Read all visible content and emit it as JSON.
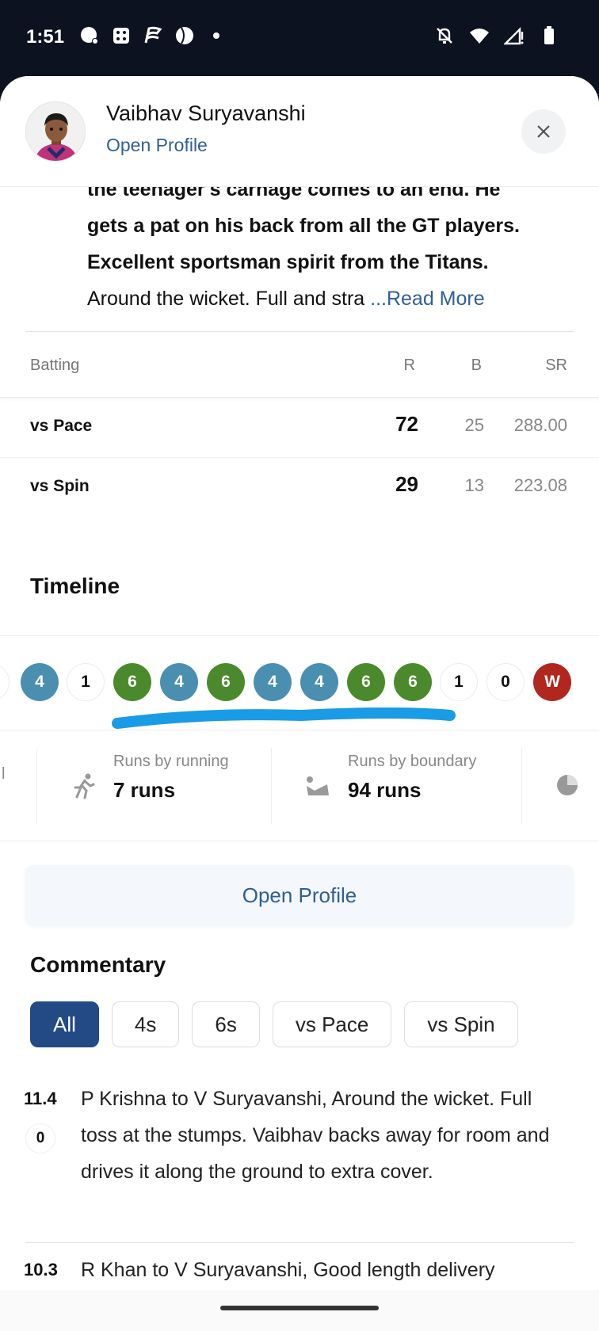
{
  "status_bar": {
    "time": "1:51",
    "notification_icons": [
      "chat-bubble-icon",
      "dice-icon",
      "flag-icon",
      "cricket-ball-icon",
      "dot-icon"
    ],
    "system_icons": [
      "bell-off-icon",
      "wifi-icon",
      "signal-icon",
      "battery-icon"
    ]
  },
  "header": {
    "player_name": "Vaibhav Suryavanshi",
    "open_profile": "Open Profile"
  },
  "summary": {
    "line1": "the teenager's carnage comes to an end. He",
    "line2": "gets a pat on his back from all the GT players.",
    "line3": "Excellent sportsman spirit from the Titans.",
    "line4": "Around the wicket. Full and stra",
    "read_more": "...Read More"
  },
  "batting": {
    "headers": {
      "label": "Batting",
      "r": "R",
      "b": "B",
      "sr": "SR"
    },
    "rows": [
      {
        "label": "vs Pace",
        "r": "72",
        "b": "25",
        "sr": "288.00"
      },
      {
        "label": "vs Spin",
        "r": "29",
        "b": "13",
        "sr": "223.08"
      }
    ]
  },
  "timeline": {
    "title": "Timeline",
    "balls": [
      "4",
      "1",
      "6",
      "4",
      "6",
      "4",
      "4",
      "6",
      "6",
      "1",
      "0",
      "W"
    ]
  },
  "stats": {
    "running": {
      "caption": "Runs by running",
      "value": "7 runs"
    },
    "boundary": {
      "caption": "Runs by boundary",
      "value": "94 runs"
    }
  },
  "open_profile_button": "Open Profile",
  "commentary": {
    "title": "Commentary",
    "filters": [
      "All",
      "4s",
      "6s",
      "vs Pace",
      "vs Spin"
    ],
    "active_filter": "All",
    "items": [
      {
        "over": "11.4",
        "runs": "0",
        "text": "P Krishna to V Suryavanshi, Around the wicket. Full toss at the stumps. Vaibhav backs away for room and drives it along the ground to extra cover."
      },
      {
        "over": "10.3",
        "runs": "",
        "text": "R Khan to V Suryavanshi, Good length delivery"
      }
    ]
  },
  "colors": {
    "four": "#4a8faf",
    "six": "#4b8a2c",
    "wicket": "#b0271e",
    "accent": "#234a85",
    "link": "#2f5f95",
    "highlight_stroke": "#1a9be6"
  }
}
